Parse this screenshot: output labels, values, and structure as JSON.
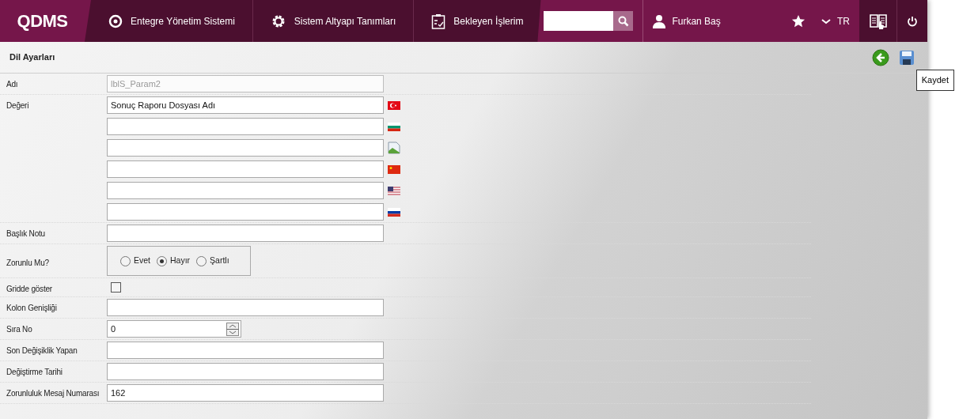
{
  "header": {
    "logo": "QDMS",
    "nav": [
      {
        "kind": "q",
        "label": "Entegre Yönetim Sistemi"
      },
      {
        "kind": "gear",
        "label": "Sistem Altyapı Tanımları"
      },
      {
        "kind": "clipboard",
        "label": "Bekleyen İşlerim"
      }
    ],
    "user": "Furkan Baş",
    "language": "TR"
  },
  "page": {
    "title": "Dil Ayarları",
    "tooltip": "Kaydet"
  },
  "form": [
    {
      "kind": "text",
      "label": "Adı",
      "value": "lblS_Param2",
      "disabled": true
    },
    {
      "kind": "translations",
      "label": "Değeri",
      "items": [
        {
          "kind": "tr",
          "value": "Sonuç Raporu Dosyası Adı"
        },
        {
          "kind": "bg"
        },
        {
          "kind": "broken"
        },
        {
          "kind": "cn"
        },
        {
          "kind": "us"
        },
        {
          "kind": "ru"
        }
      ]
    },
    {
      "kind": "text",
      "label": "Başlık Notu",
      "disabled": false
    },
    {
      "kind": "radio",
      "label": "Zorunlu Mu?",
      "options": [
        {
          "label": "Evet",
          "selected": false
        },
        {
          "label": "Hayır",
          "selected": true
        },
        {
          "label": "Şartlı",
          "selected": false
        }
      ]
    },
    {
      "kind": "checkbox",
      "label": "Gridde göster",
      "checked": false
    },
    {
      "kind": "text",
      "label": "Kolon Genişliği",
      "disabled": false
    },
    {
      "kind": "spinner",
      "label": "Sıra No",
      "value": "0"
    },
    {
      "kind": "text",
      "label": "Son Değişiklik Yapan",
      "disabled": false
    },
    {
      "kind": "text",
      "label": "Değiştirme Tarihi",
      "disabled": false
    },
    {
      "kind": "text",
      "label": "Zorunluluk Mesaj Numarası",
      "value": "162",
      "disabled": false
    }
  ]
}
